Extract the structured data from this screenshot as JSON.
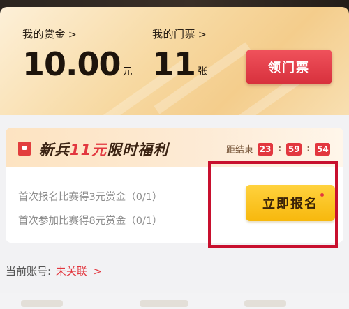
{
  "wallet": {
    "bounty_label": "我的赏金",
    "bounty_value": "10.00",
    "bounty_unit": "元",
    "tickets_label": "我的门票",
    "tickets_value": "11",
    "tickets_unit": "张",
    "claim_button": "领门票",
    "chevron": ">"
  },
  "welfare": {
    "title_prefix": "新兵",
    "title_highlight": "11元",
    "title_suffix": "限时福利",
    "countdown_label": "距结束",
    "countdown": [
      "23",
      "59",
      "54"
    ],
    "countdown_sep": ":",
    "tasks": [
      "首次报名比赛得3元赏金（0/1）",
      "首次参加比赛得8元赏金（0/1）"
    ],
    "signup_button": "立即报名"
  },
  "account": {
    "label": "当前账号:",
    "status": "未关联",
    "chevron": ">"
  },
  "colors": {
    "accent_red": "#e2373f",
    "signup_yellow": "#f7b80d",
    "highlight_border": "#c8102e"
  },
  "icons": {
    "gift": "gift-icon",
    "chevron": "chevron-right-icon"
  }
}
